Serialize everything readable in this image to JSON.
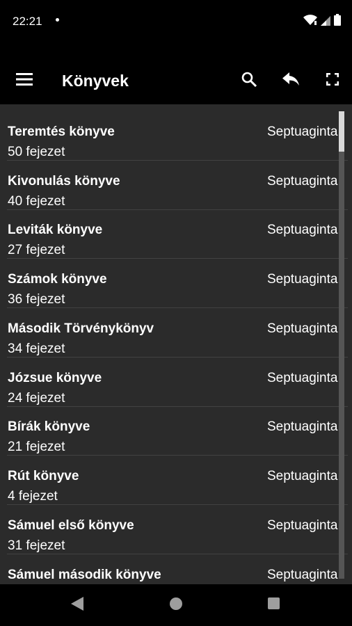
{
  "status_bar": {
    "time": "22:21",
    "icons": [
      "notification-dot-icon",
      "wifi-icon",
      "cell-signal-icon",
      "battery-icon"
    ]
  },
  "toolbar": {
    "title": "Könyvek",
    "icons": [
      "menu-icon",
      "search-icon",
      "reply-icon",
      "fullscreen-icon"
    ]
  },
  "books": [
    {
      "name": "Teremtés könyve",
      "chapters": "50 fejezet",
      "canon": "Septuaginta"
    },
    {
      "name": "Kivonulás könyve",
      "chapters": "40 fejezet",
      "canon": "Septuaginta"
    },
    {
      "name": "Leviták könyve",
      "chapters": "27 fejezet",
      "canon": "Septuaginta"
    },
    {
      "name": "Számok könyve",
      "chapters": "36 fejezet",
      "canon": "Septuaginta"
    },
    {
      "name": "Második Törvénykönyv",
      "chapters": "34 fejezet",
      "canon": "Septuaginta"
    },
    {
      "name": "Józsue könyve",
      "chapters": "24 fejezet",
      "canon": "Septuaginta"
    },
    {
      "name": "Bírák könyve",
      "chapters": "21 fejezet",
      "canon": "Septuaginta"
    },
    {
      "name": "Rút könyve",
      "chapters": "4 fejezet",
      "canon": "Septuaginta"
    },
    {
      "name": "Sámuel első könyve",
      "chapters": "31 fejezet",
      "canon": "Septuaginta"
    },
    {
      "name": "Sámuel második könyve",
      "chapters": "",
      "canon": "Septuaginta"
    }
  ],
  "scroll_position": 0,
  "nav_bar": {
    "icons": [
      "back-triangle-icon",
      "home-circle-icon",
      "recents-square-icon"
    ]
  },
  "colors": {
    "background": "#000000",
    "list_background": "#2b2b2b",
    "divider": "#424242",
    "text": "#ffffff"
  }
}
